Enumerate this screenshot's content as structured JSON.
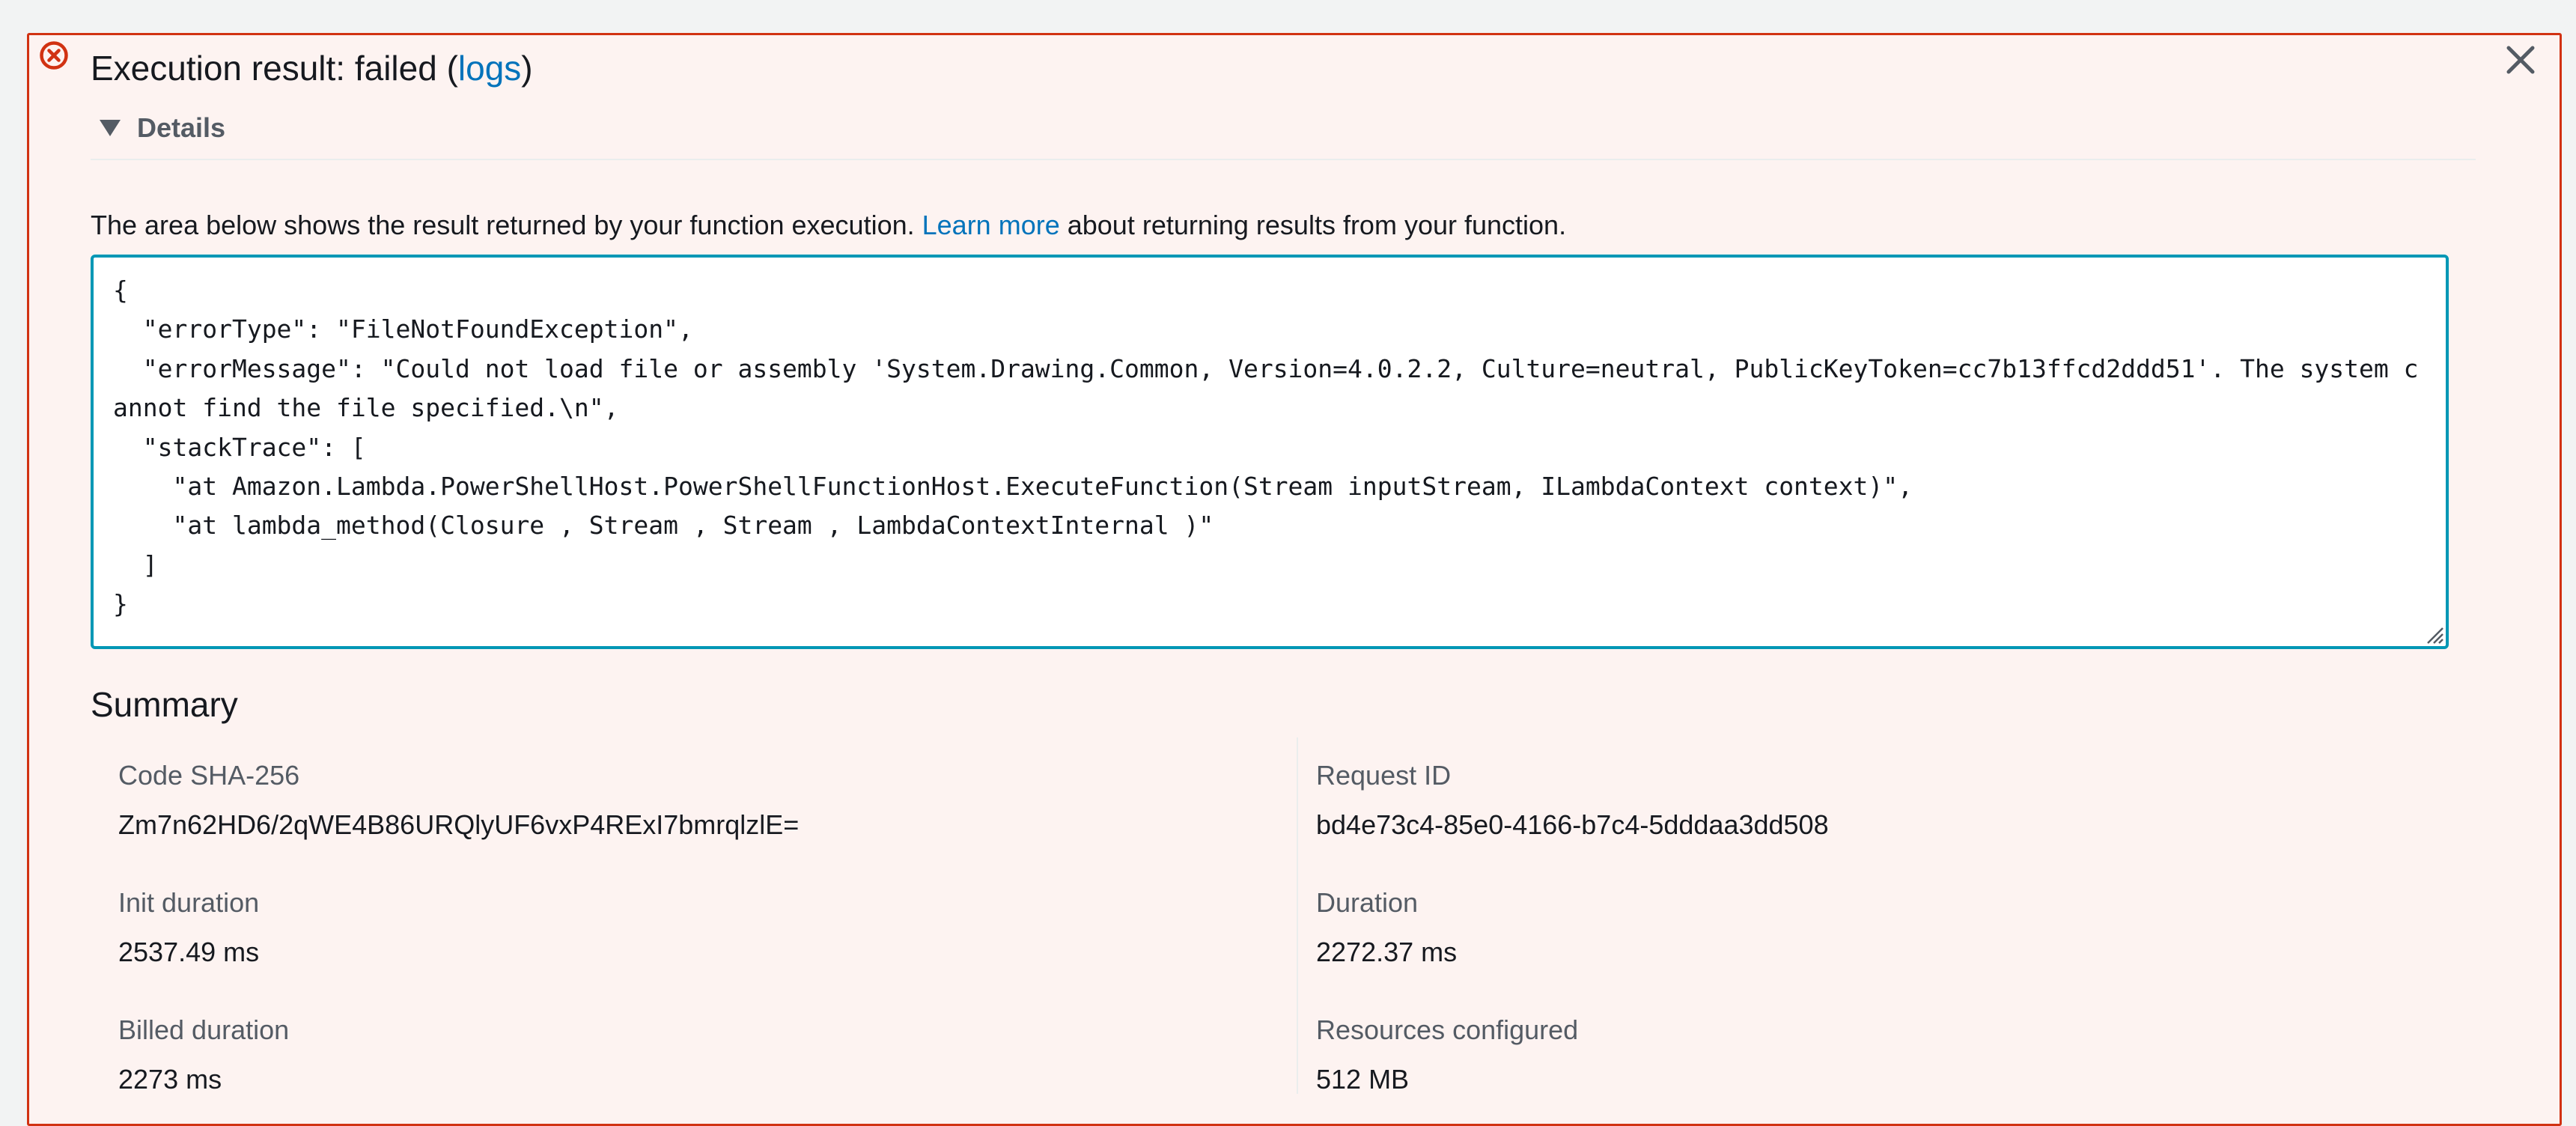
{
  "alert": {
    "title_prefix": "Execution result: failed (",
    "logs_link": "logs",
    "title_suffix": ")",
    "details_label": "Details",
    "description_before": "The area below shows the result returned by your function execution. ",
    "learn_more_link": "Learn more",
    "description_after": " about returning results from your function.",
    "result_text": "{\n  \"errorType\": \"FileNotFoundException\",\n  \"errorMessage\": \"Could not load file or assembly 'System.Drawing.Common, Version=4.0.2.2, Culture=neutral, PublicKeyToken=cc7b13ffcd2ddd51'. The system cannot find the file specified.\\n\",\n  \"stackTrace\": [\n    \"at Amazon.Lambda.PowerShellHost.PowerShellFunctionHost.ExecuteFunction(Stream inputStream, ILambdaContext context)\",\n    \"at lambda_method(Closure , Stream , Stream , LambdaContextInternal )\"\n  ]\n}",
    "error_icon": "error-circle-icon",
    "close_icon": "close-icon",
    "caret_icon": "caret-down-icon"
  },
  "summary": {
    "heading": "Summary",
    "left": [
      {
        "label": "Code SHA-256",
        "value": "Zm7n62HD6/2qWE4B86URQlyUF6vxP4RExI7bmrqlzlE="
      },
      {
        "label": "Init duration",
        "value": "2537.49 ms"
      },
      {
        "label": "Billed duration",
        "value": "2273 ms"
      }
    ],
    "right": [
      {
        "label": "Request ID",
        "value": "bd4e73c4-85e0-4166-b7c4-5dddaa3dd508"
      },
      {
        "label": "Duration",
        "value": "2272.37 ms"
      },
      {
        "label": "Resources configured",
        "value": "512 MB"
      }
    ]
  },
  "colors": {
    "error": "#d13212",
    "alert_background": "#fdf3f1",
    "link": "#0073bb",
    "focus_border": "#0097b5"
  }
}
